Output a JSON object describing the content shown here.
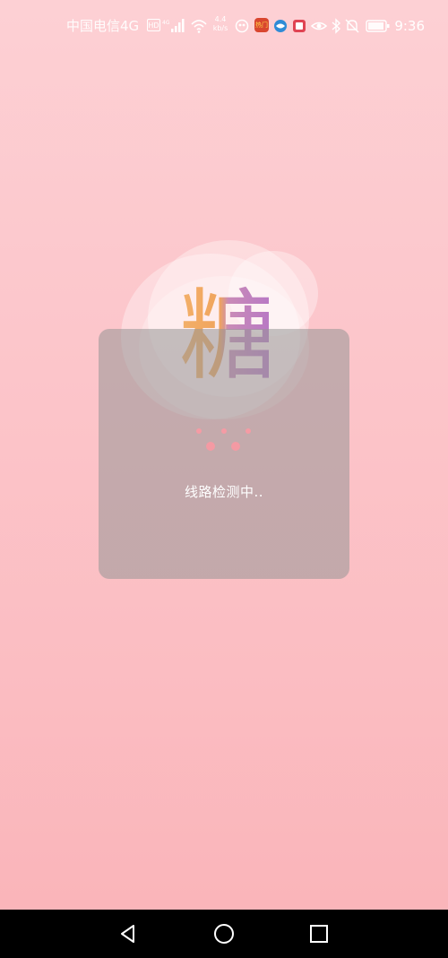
{
  "status_bar": {
    "carrier": "中国电信4G",
    "hd": "HD",
    "signal_label": "4G",
    "net_speed_value": "4.4",
    "net_speed_unit": "kb/s",
    "app_badge_label": "热门",
    "time": "9:36",
    "icons": [
      "hd-icon",
      "signal-icon",
      "wifi-icon",
      "net-speed",
      "vpn-icon",
      "app-badge-icon",
      "browser-icon",
      "app-icon",
      "eye-icon",
      "bluetooth-icon",
      "mute-icon",
      "battery-icon"
    ]
  },
  "splash": {
    "logo_char": "糖",
    "loading_text": "线路检测中.."
  },
  "colors": {
    "background_top": "#fdd0d4",
    "background_bottom": "#fab3b8",
    "dialog": "#969696",
    "dot": "#f59ba4",
    "logo_orange": "#f0a45c",
    "logo_purple": "#b979c4"
  },
  "nav_bar": {
    "buttons": [
      "back-icon",
      "home-icon",
      "recents-icon"
    ]
  }
}
